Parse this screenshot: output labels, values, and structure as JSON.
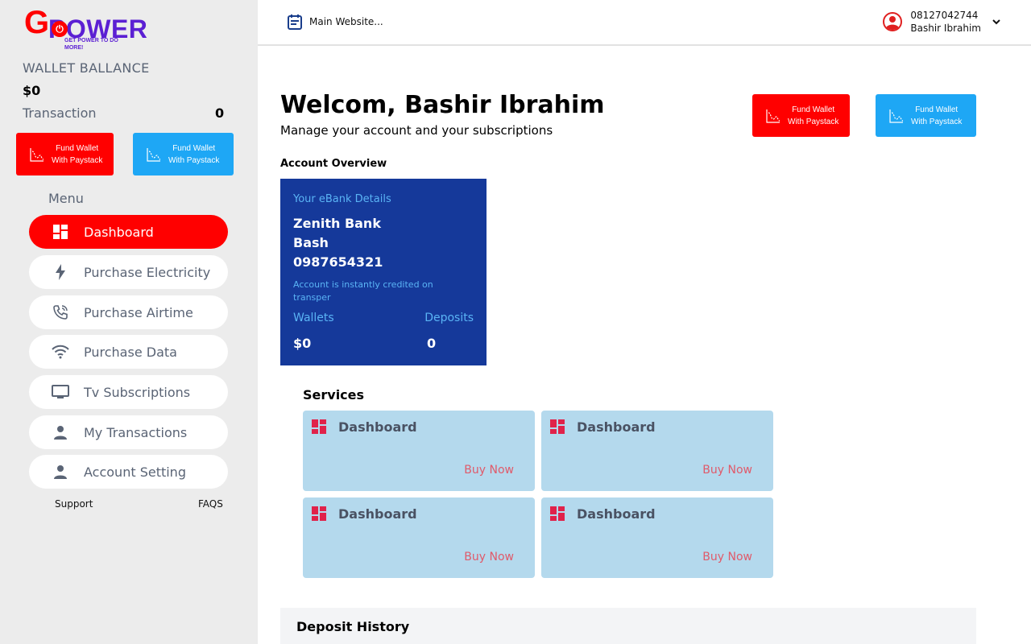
{
  "brand": {
    "logo_g": "G",
    "logo_power": "POWER",
    "tagline": "GET POWER TO DO MORE!"
  },
  "sidebar": {
    "wallet_label": "WALLET BALLANCE",
    "wallet_value": "$0",
    "transaction_label": "Transaction",
    "transaction_value": "0",
    "fund_red": {
      "line1": "Fund Wallet",
      "line2": "With Paystack"
    },
    "fund_blue": {
      "line1": "Fund Wallet",
      "line2": "With Paystack"
    },
    "menu_title": "Menu",
    "items": [
      {
        "label": "Dashboard",
        "icon": "dashboard-icon",
        "active": true
      },
      {
        "label": "Purchase Electricity",
        "icon": "bolt-icon"
      },
      {
        "label": "Purchase Airtime",
        "icon": "phone-icon"
      },
      {
        "label": "Purchase Data",
        "icon": "wifi-icon"
      },
      {
        "label": "Tv Subscriptions",
        "icon": "tv-icon"
      },
      {
        "label": "My Transactions",
        "icon": "person-icon"
      },
      {
        "label": "Account Setting",
        "icon": "person-icon"
      }
    ],
    "support": "Support",
    "faqs": "FAQS"
  },
  "header": {
    "main_link": "Main Website...",
    "phone": "08127042744",
    "user_name": "Bashir Ibrahim"
  },
  "main": {
    "welcome": "Welcom, Bashir Ibrahim",
    "subtitle": "Manage your account and your subscriptions",
    "fund_red": {
      "line1": "Fund Wallet",
      "line2": "With Paystack"
    },
    "fund_blue": {
      "line1": "Fund Wallet",
      "line2": "With Paystack"
    },
    "overview_label": "Account Overview",
    "bank_card": {
      "title": "Your eBank Details",
      "bank": "Zenith Bank",
      "holder": "Bash",
      "account": "0987654321",
      "note": "Account is instantly credited on transper",
      "wallets_label": "Wallets",
      "deposits_label": "Deposits",
      "wallets_value": "$0",
      "deposits_value": "0"
    },
    "services_label": "Services",
    "services": [
      {
        "title": "Dashboard",
        "action": "Buy Now"
      },
      {
        "title": "Dashboard",
        "action": "Buy Now"
      },
      {
        "title": "Dashboard",
        "action": "Buy Now"
      },
      {
        "title": "Dashboard",
        "action": "Buy Now"
      }
    ],
    "deposit_history": "Deposit History"
  },
  "colors": {
    "accent_red": "#ff0000",
    "accent_blue": "#1ea7f5",
    "card_blue": "#15399a",
    "service_bg": "#b4d9ed",
    "buy_now": "#e05a6a"
  }
}
